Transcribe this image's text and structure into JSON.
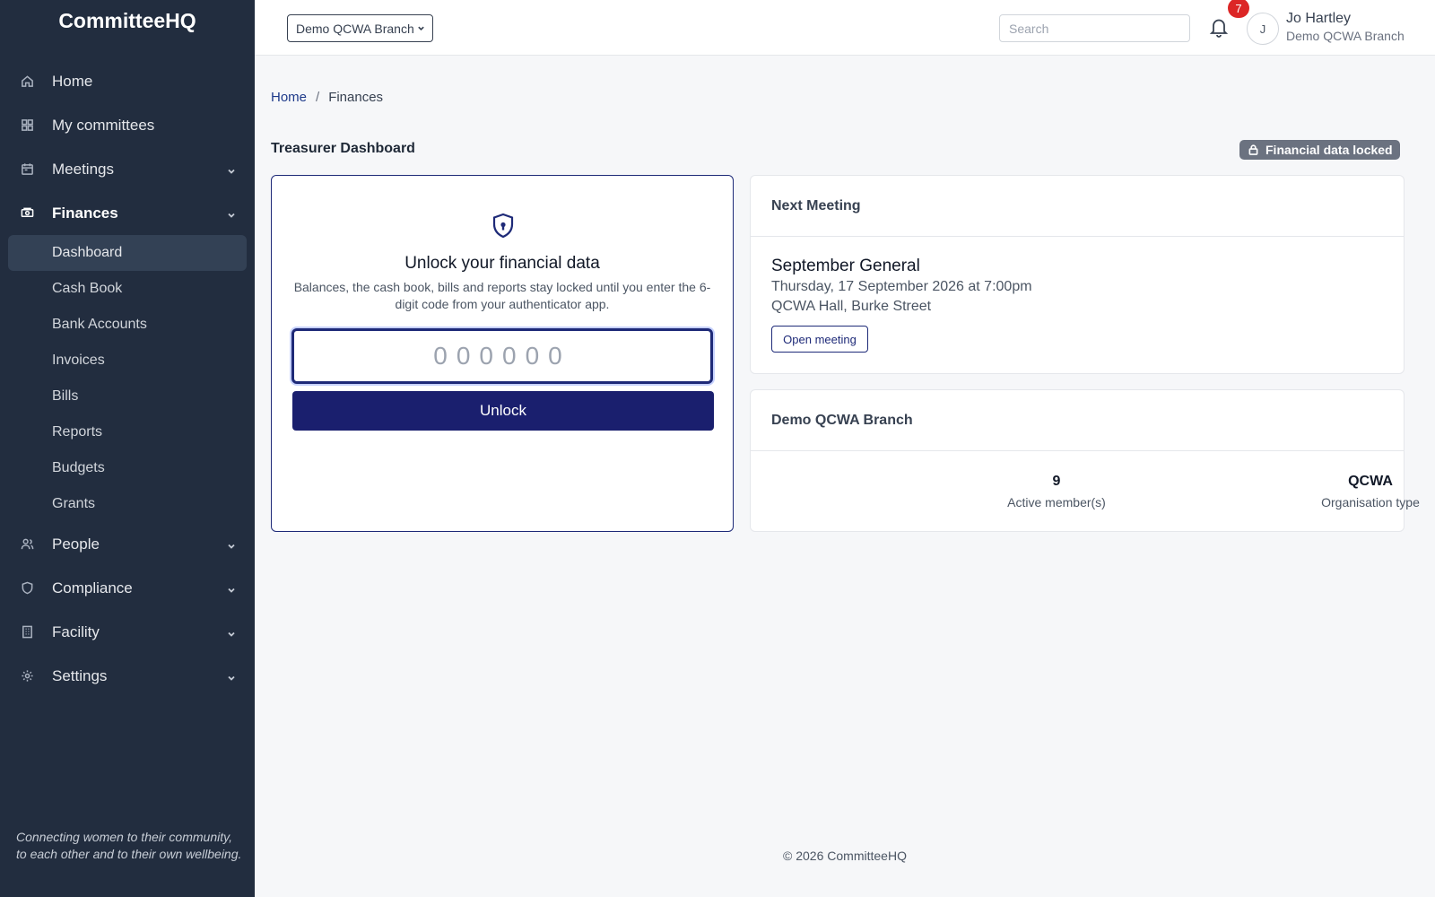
{
  "app": {
    "brand": "CommitteeHQ",
    "tagline": "Connecting women to their community, to each other and to their own wellbeing."
  },
  "sidebar": {
    "items": [
      {
        "label": "Home",
        "icon": "home-icon"
      },
      {
        "label": "My committees",
        "icon": "grid-icon"
      },
      {
        "label": "Meetings",
        "icon": "calendar-icon",
        "expandable": true
      },
      {
        "label": "Finances",
        "icon": "money-icon",
        "expandable": true,
        "active": true
      },
      {
        "label": "People",
        "icon": "people-icon",
        "expandable": true
      },
      {
        "label": "Compliance",
        "icon": "shield-icon",
        "expandable": true
      },
      {
        "label": "Facility",
        "icon": "building-icon",
        "expandable": true
      },
      {
        "label": "Settings",
        "icon": "gear-icon",
        "expandable": true
      }
    ],
    "finances_sub": [
      "Dashboard",
      "Cash Book",
      "Bank Accounts",
      "Invoices",
      "Bills",
      "Reports",
      "Budgets",
      "Grants"
    ],
    "current_sub": "Dashboard"
  },
  "topbar": {
    "org_select": "Demo QCWA Branch",
    "search_placeholder": "Search",
    "notifications": "7",
    "avatar_initial": "J",
    "user_name": "Jo Hartley",
    "user_org": "Demo QCWA Branch"
  },
  "breadcrumb": {
    "home": "Home",
    "sep": "/",
    "current": "Finances"
  },
  "page": {
    "title": "Treasurer Dashboard",
    "lock_status": "Financial data locked"
  },
  "unlock": {
    "title": "Unlock your financial data",
    "description": "Balances, the cash book, bills and reports stay locked until you enter the 6-digit code from your authenticator app.",
    "code_placeholder": "000000",
    "button": "Unlock"
  },
  "next_meeting": {
    "heading": "Next Meeting",
    "name": "September General",
    "date": "Thursday, 17 September 2026 at 7:00pm",
    "place": "QCWA Hall, Burke Street",
    "button": "Open meeting"
  },
  "branch": {
    "heading": "Demo QCWA Branch",
    "members_value": "9",
    "members_label": "Active member(s)",
    "type_value": "QCWA",
    "type_label": "Organisation type"
  },
  "footer": "© 2026 CommitteeHQ",
  "colors": {
    "sidebar": "#222d3f",
    "primary": "#1a1f6e",
    "badge": "#dc2626",
    "lock_badge": "#6b7280"
  }
}
